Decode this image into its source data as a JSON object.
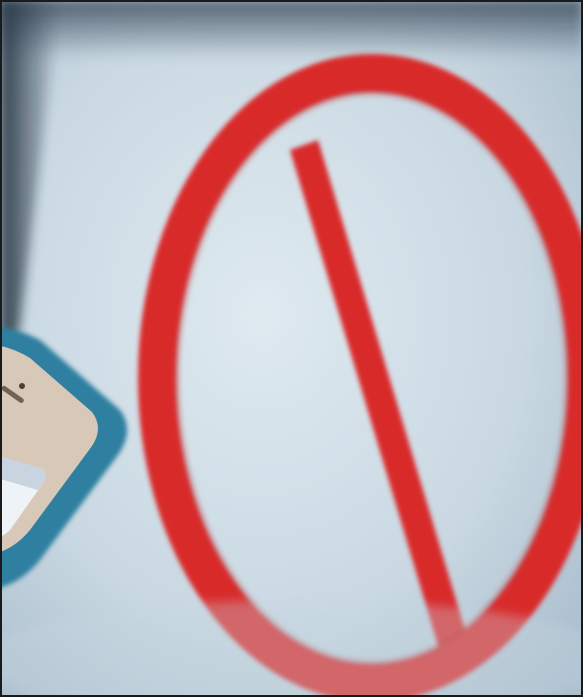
{
  "photo": {
    "colors": {
      "backdrop_light": "#d9e6ee",
      "backdrop_mid": "#b9cad5",
      "backdrop_dark": "#7f9bb0",
      "top_shadow": "#2a3a4c",
      "sign_red": "#d92b2b",
      "sign_red_dark": "#b51f20",
      "phone_case": "#2f7fa0",
      "phone_body": "#d8c8b8",
      "phone_screen": "#eef3f8",
      "frame_border": "#1a1a1a"
    },
    "objects": [
      "prohibition-sign",
      "smartphone"
    ]
  }
}
